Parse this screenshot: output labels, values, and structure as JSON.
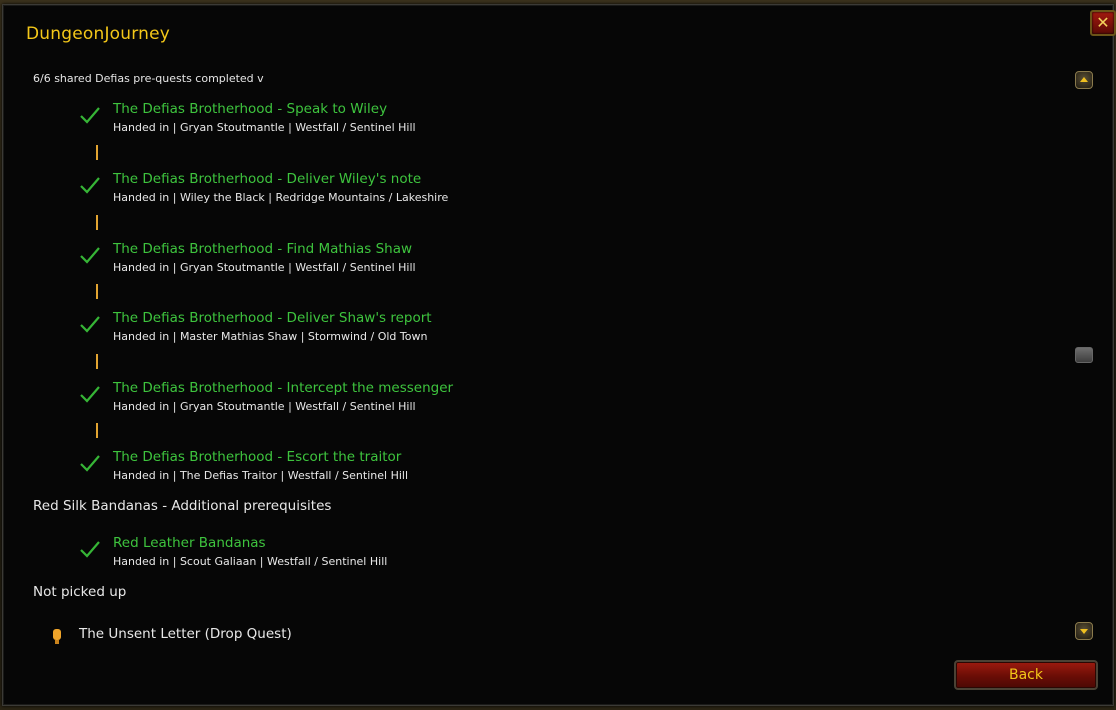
{
  "window": {
    "title": "DungeonJourney",
    "close_glyph": "✕"
  },
  "summary": {
    "text": "6/6 shared Defias pre-quests completed  v"
  },
  "chain_quests": [
    {
      "title": "The Defias Brotherhood - Speak to Wiley",
      "detail": "Handed in | Gryan Stoutmantle | Westfall / Sentinel Hill",
      "status_icon": "check-icon"
    },
    {
      "title": "The Defias Brotherhood - Deliver Wiley's note",
      "detail": "Handed in | Wiley the Black | Redridge Mountains / Lakeshire",
      "status_icon": "check-icon"
    },
    {
      "title": "The Defias Brotherhood - Find Mathias Shaw",
      "detail": "Handed in | Gryan Stoutmantle | Westfall / Sentinel Hill",
      "status_icon": "check-icon"
    },
    {
      "title": "The Defias Brotherhood - Deliver Shaw's report",
      "detail": "Handed in | Master Mathias Shaw | Stormwind / Old Town",
      "status_icon": "check-icon"
    },
    {
      "title": "The Defias Brotherhood - Intercept the messenger",
      "detail": "Handed in | Gryan Stoutmantle | Westfall / Sentinel Hill",
      "status_icon": "check-icon"
    },
    {
      "title": "The Defias Brotherhood - Escort the traitor",
      "detail": "Handed in | The Defias Traitor | Westfall / Sentinel Hill",
      "status_icon": "check-icon"
    }
  ],
  "additional": {
    "heading": "Red Silk Bandanas - Additional prerequisites",
    "quests": [
      {
        "title": "Red Leather Bandanas",
        "detail": "Handed in | Scout Galiaan | Westfall / Sentinel Hill",
        "status_icon": "check-icon"
      }
    ]
  },
  "not_picked_up": {
    "heading": "Not picked up",
    "items": [
      {
        "label": "The Unsent Letter (Drop Quest)",
        "icon": "quest-item-icon"
      }
    ]
  },
  "scrollbar": {
    "up_icon": "scroll-up-icon",
    "down_icon": "scroll-down-icon"
  },
  "footer": {
    "back_label": "Back"
  },
  "colors": {
    "title_gold": "#f3c719",
    "quest_green": "#3ec43e",
    "connector_orange": "#e2a431",
    "button_red": "#9d1b0f"
  }
}
